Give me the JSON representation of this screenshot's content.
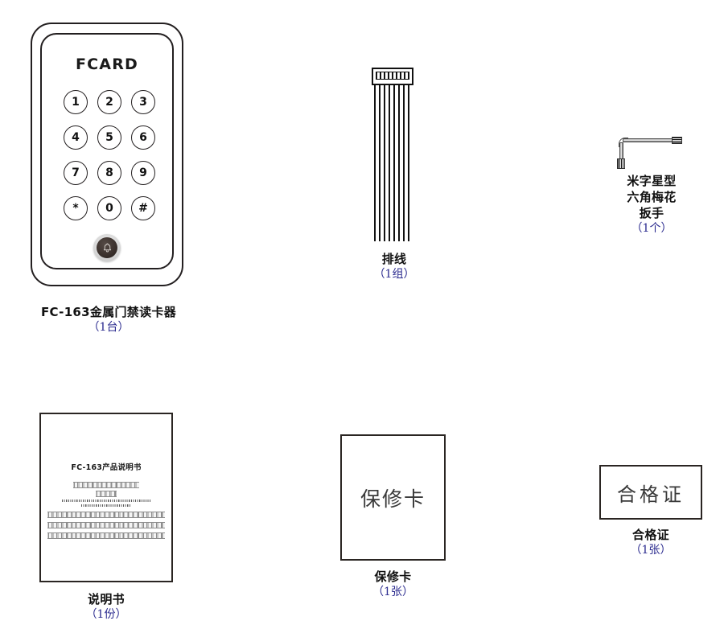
{
  "page": {
    "title": "FC-163 Access Control Reader Packing List",
    "background": "#ffffff",
    "caption_name_color": "#111111",
    "caption_qty_color": "#2b2b8f"
  },
  "items": [
    {
      "id": "reader",
      "name": "FC-163金属门禁读卡器",
      "qty": "（1台）",
      "brand": "FCARD",
      "keys": [
        "1",
        "2",
        "3",
        "4",
        "5",
        "6",
        "7",
        "8",
        "9",
        "*",
        "0",
        "#"
      ],
      "bell_icon": "bell-icon"
    },
    {
      "id": "cable",
      "name": "排线",
      "qty": "（1组）"
    },
    {
      "id": "wrench",
      "name": "米字星型六角梅花扳手",
      "name_lines": [
        "米字星型",
        "六角梅花",
        "扳手"
      ],
      "qty": "（1个）"
    },
    {
      "id": "manual",
      "name": "说明书",
      "qty": "（1份）",
      "doc_title": "FC-163产品说明书"
    },
    {
      "id": "warranty",
      "name": "保修卡",
      "qty": "（1张）",
      "face_text": "保修卡"
    },
    {
      "id": "certificate",
      "name": "合格证",
      "qty": "（1张）",
      "face_text": "合格证"
    }
  ]
}
